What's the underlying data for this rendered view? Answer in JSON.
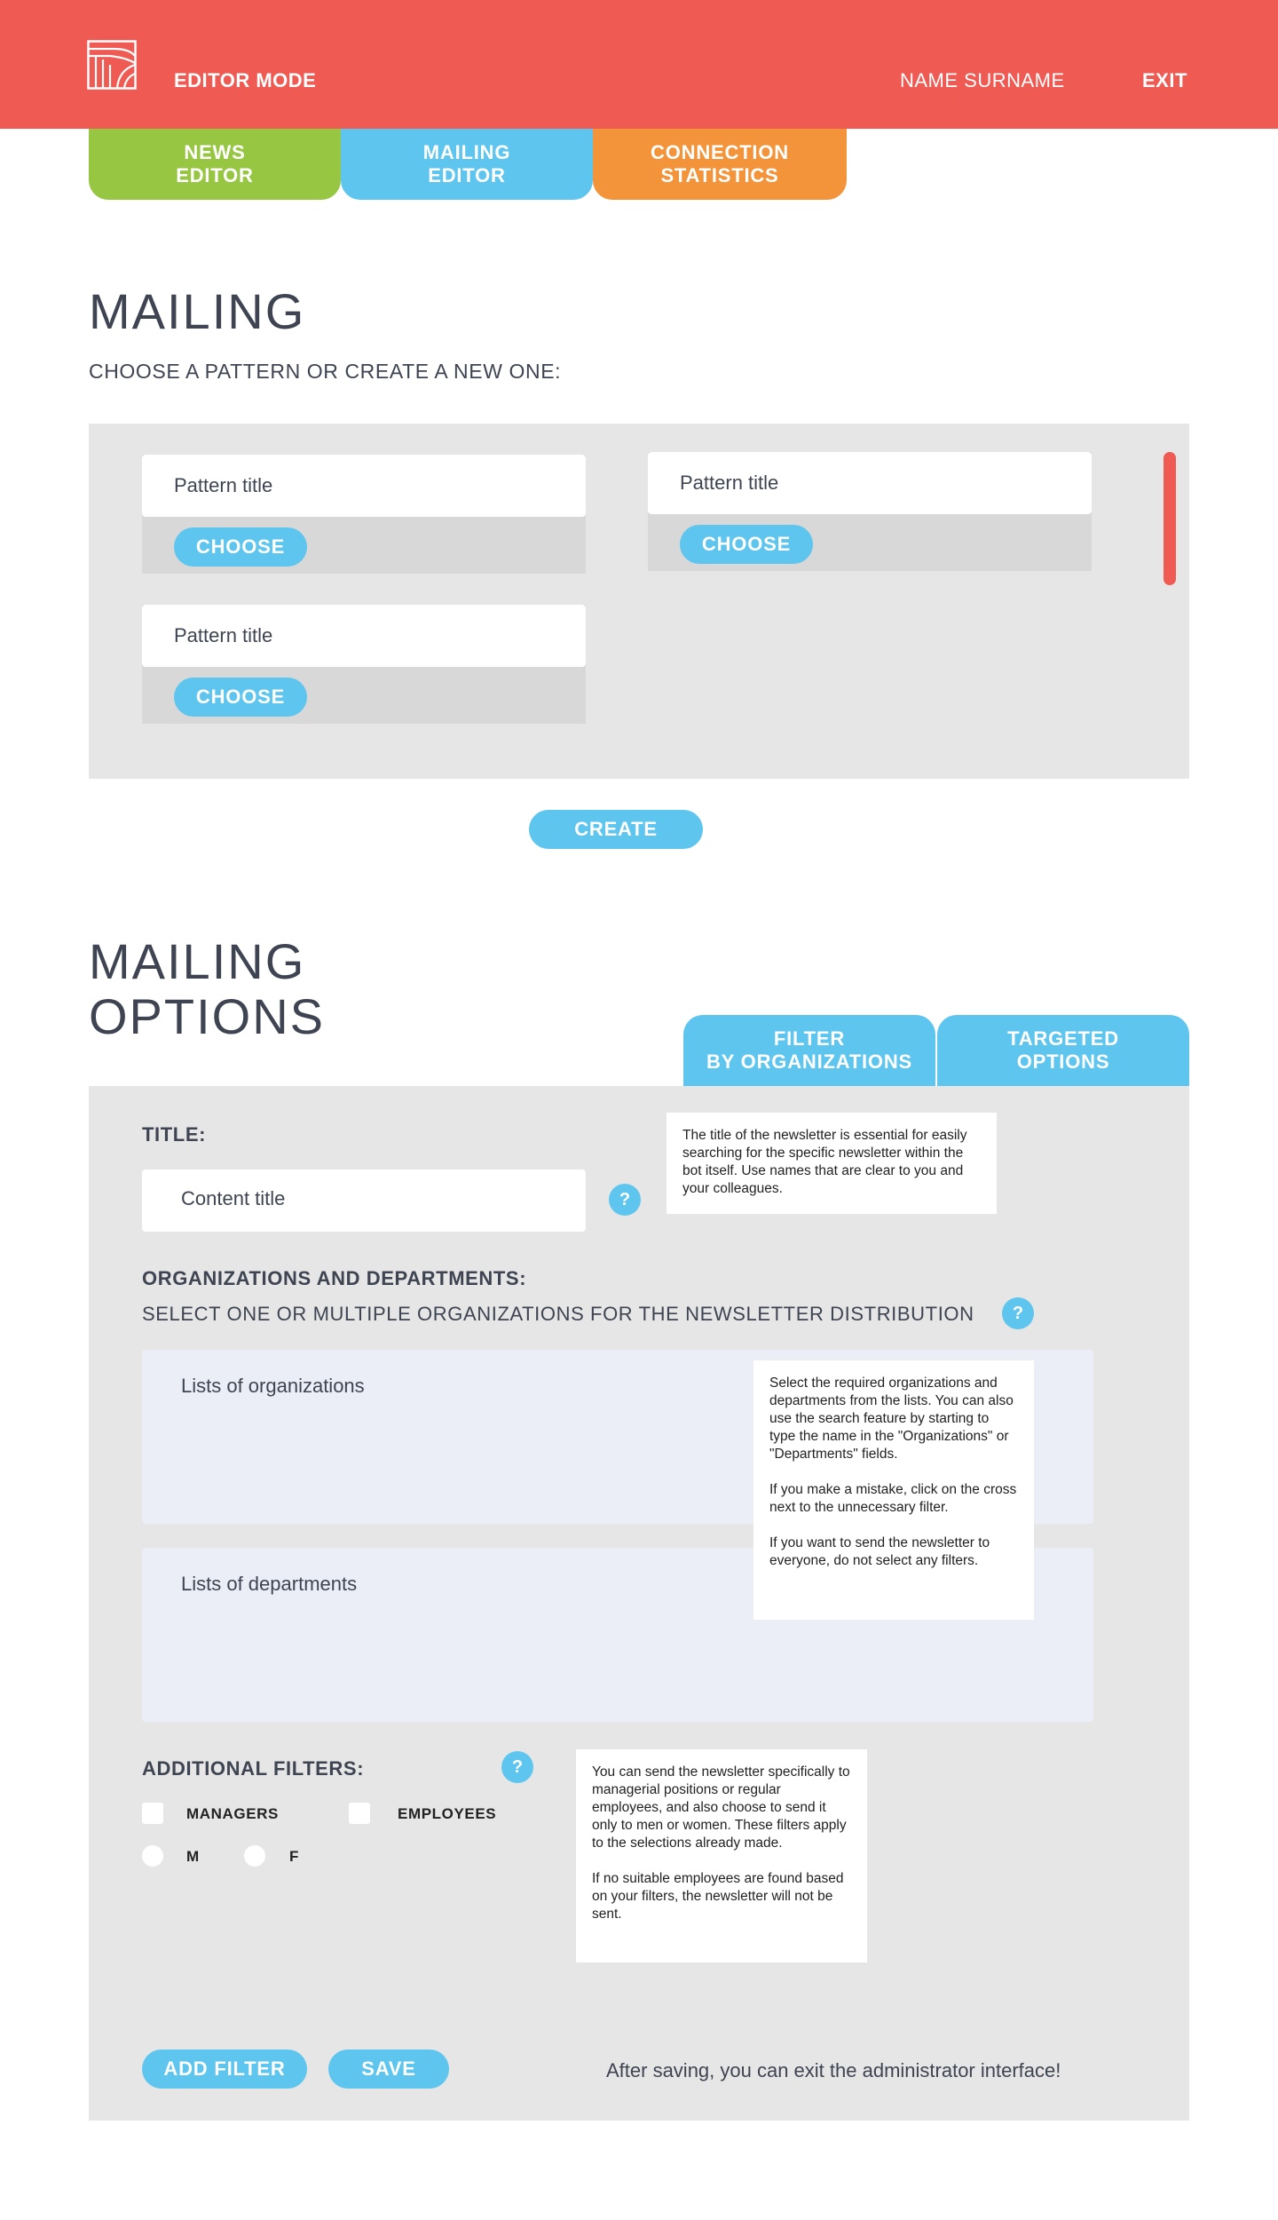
{
  "header": {
    "mode": "EDITOR MODE",
    "user": "NAME SURNAME",
    "exit": "EXIT"
  },
  "nav_tabs": [
    {
      "line1": "NEWS",
      "line2": "EDITOR",
      "color": "#97c643"
    },
    {
      "line1": "MAILING",
      "line2": "EDITOR",
      "color": "#5ec5ef"
    },
    {
      "line1": "CONNECTION",
      "line2": "STATISTICS",
      "color": "#f3943b"
    }
  ],
  "mailing": {
    "title": "MAILING",
    "subtitle": "CHOOSE A PATTERN OR CREATE A NEW ONE:",
    "patterns": [
      {
        "title": "Pattern title",
        "button": "CHOOSE"
      },
      {
        "title": "Pattern title",
        "button": "CHOOSE"
      },
      {
        "title": "Pattern title",
        "button": "CHOOSE"
      }
    ],
    "create_button": "CREATE"
  },
  "options": {
    "title_line1": "MAILING",
    "title_line2": "OPTIONS",
    "tabs": [
      {
        "line1": "FILTER",
        "line2": "BY ORGANIZATIONS"
      },
      {
        "line1": "TARGETED",
        "line2": "OPTIONS"
      }
    ],
    "title_label": "TITLE:",
    "title_placeholder": "Content title",
    "title_tip": "The title of the newsletter is essential for easily searching for the specific newsletter within the bot itself. Use names that are clear to you and your colleagues.",
    "org_label": "ORGANIZATIONS AND DEPARTMENTS:",
    "org_sub": "SELECT ONE OR MULTIPLE ORGANIZATIONS FOR THE NEWSLETTER DISTRIBUTION",
    "org_list": "Lists of organizations",
    "dept_list": "Lists of departments",
    "org_tip_1": "Select the required organizations and departments from the lists. You can also use the search feature by starting to type the name in the \"Organizations\" or \"Departments\" fields.",
    "org_tip_2": "If you make a mistake, click on the cross next to the unnecessary filter.",
    "org_tip_3": "If you want to send the newsletter to everyone, do not select any filters.",
    "filters_label": "ADDITIONAL FILTERS:",
    "managers": "MANAGERS",
    "employees": "EMPLOYEES",
    "male": "M",
    "female": "F",
    "filters_tip_1": "You can send the newsletter specifically to managerial positions or regular employees, and also choose to send it only to men or women. These filters apply to the selections already made.",
    "filters_tip_2": "If no suitable employees are found based on your filters, the newsletter will not be sent.",
    "help_glyph": "?",
    "add_filter": "ADD FILTER",
    "save": "SAVE",
    "save_note": "After saving, you can exit the administrator interface!"
  },
  "colors": {
    "header": "#ef5a53",
    "accent_blue": "#5ec5ef",
    "panel": "#e6e6e6",
    "list_bg": "#ebeef7"
  },
  "icons": [
    "logo-icon",
    "help-icon"
  ]
}
